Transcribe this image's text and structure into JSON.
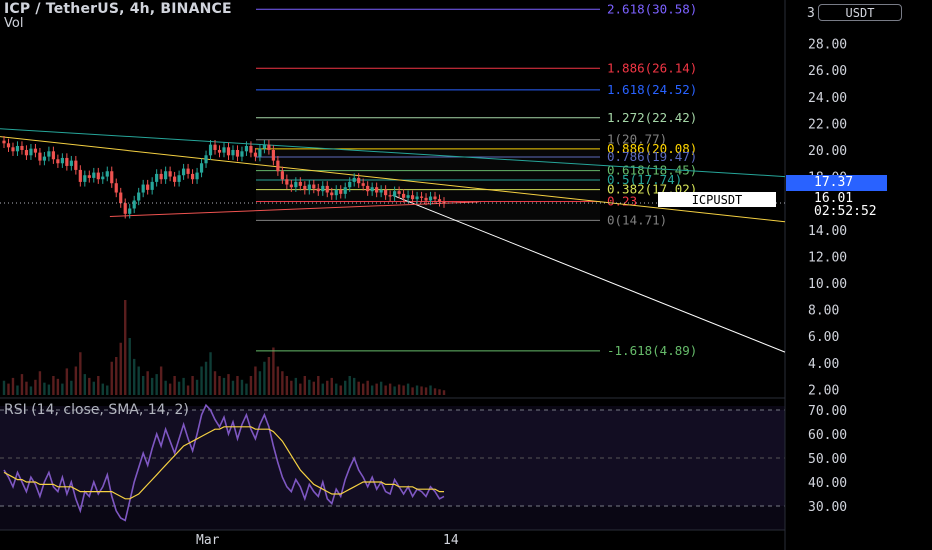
{
  "header": {
    "title": "ICP / TetherUS, 4h, BINANCE",
    "vol_label": "Vol"
  },
  "axis": {
    "unit_button": "USDT",
    "price_ticks": [
      "28.00",
      "26.00",
      "24.00",
      "22.00",
      "20.00",
      "18.00",
      "14.00",
      "12.00",
      "10.00",
      "8.00",
      "6.00",
      "4.00",
      "2.00"
    ],
    "top_tick": "3",
    "rsi_ticks": [
      "70.00",
      "60.00",
      "50.00",
      "40.00",
      "30.00"
    ],
    "time_labels": [
      "Mar",
      "14"
    ]
  },
  "tags": {
    "price_17": "17.37",
    "last_price": "16.01",
    "countdown": "02:52:52",
    "symbol": "ICPUSDT"
  },
  "rsi": {
    "label": "RSI (14, close, SMA, 14, 2)"
  },
  "colors": {
    "up": "#26a69a",
    "down": "#ef5350",
    "rsi_line": "#7e57c2",
    "rsi_sma": "#f5d142",
    "background": "#000000",
    "blue_tag": "#2962ff"
  },
  "chart_data": {
    "type": "candlestick",
    "symbol": "ICPUSDT",
    "interval": "4h",
    "y_range": [
      1.2,
      30.9
    ],
    "last_price": 16.01,
    "fib_levels": [
      {
        "ratio": "2.618",
        "price": 30.58,
        "label": "2.618(30.58)",
        "color": "#7b61ff"
      },
      {
        "ratio": "1.886",
        "price": 26.14,
        "label": "1.886(26.14)",
        "color": "#f23645"
      },
      {
        "ratio": "1.618",
        "price": 24.52,
        "label": "1.618(24.52)",
        "color": "#2962ff"
      },
      {
        "ratio": "1.272",
        "price": 22.42,
        "label": "1.272(22.42)",
        "color": "#a5d6a7"
      },
      {
        "ratio": "1",
        "price": 20.77,
        "label": "1(20.77)",
        "color": "#808080"
      },
      {
        "ratio": "0.886",
        "price": 20.08,
        "label": "0.886(20.08)",
        "color": "#ffd600"
      },
      {
        "ratio": "0.786",
        "price": 19.47,
        "label": "0.786(19.47)",
        "color": "#5c6bc0"
      },
      {
        "ratio": "0.618",
        "price": 18.45,
        "label": "0.618(18.45)",
        "color": "#66bb6a"
      },
      {
        "ratio": "0.5",
        "price": 17.74,
        "label": "0.5(17.74)",
        "color": "#26a69a"
      },
      {
        "ratio": "0.382",
        "price": 17.02,
        "label": "0.382(17.02)",
        "color": "#d4e157"
      },
      {
        "ratio": "0.236",
        "price": 16.13,
        "label": "0.23",
        "color": "#f23645"
      },
      {
        "ratio": "0",
        "price": 14.71,
        "label": "0(14.71)",
        "color": "#808080"
      },
      {
        "ratio": "-1.618",
        "price": 4.89,
        "label": "-1.618(4.89)",
        "color": "#66bb6a"
      }
    ],
    "closes": [
      20.5,
      20.2,
      19.9,
      20.3,
      20.0,
      19.6,
      20.1,
      19.8,
      19.2,
      19.5,
      19.9,
      19.3,
      19.0,
      19.4,
      18.8,
      19.2,
      18.5,
      17.6,
      18.1,
      17.9,
      18.3,
      17.8,
      18.0,
      18.4,
      17.5,
      16.8,
      16.0,
      15.2,
      15.6,
      16.2,
      16.8,
      17.4,
      17.0,
      17.6,
      18.2,
      17.8,
      18.4,
      18.0,
      17.6,
      18.1,
      18.6,
      18.2,
      17.8,
      18.3,
      19.0,
      19.6,
      20.4,
      20.0,
      19.8,
      20.2,
      19.6,
      20.0,
      19.5,
      19.9,
      20.3,
      19.8,
      19.5,
      20.1,
      20.4,
      20.0,
      19.2,
      18.4,
      17.8,
      17.4,
      17.2,
      17.6,
      17.3,
      17.0,
      17.4,
      17.1,
      16.9,
      17.3,
      16.8,
      16.6,
      17.0,
      16.7,
      17.2,
      17.6,
      17.9,
      17.5,
      17.3,
      16.9,
      17.2,
      16.8,
      17.0,
      16.6,
      16.5,
      16.9,
      16.7,
      16.4,
      16.6,
      16.3,
      16.5,
      16.4,
      16.2,
      16.5,
      16.3,
      16.1,
      16.0
    ],
    "volume_relative": [
      0.15,
      0.12,
      0.18,
      0.1,
      0.22,
      0.14,
      0.09,
      0.16,
      0.25,
      0.13,
      0.11,
      0.2,
      0.17,
      0.12,
      0.28,
      0.15,
      0.3,
      0.45,
      0.22,
      0.18,
      0.14,
      0.2,
      0.12,
      0.1,
      0.35,
      0.4,
      0.55,
      1.0,
      0.6,
      0.38,
      0.3,
      0.2,
      0.25,
      0.18,
      0.22,
      0.3,
      0.15,
      0.12,
      0.2,
      0.14,
      0.18,
      0.1,
      0.2,
      0.16,
      0.3,
      0.35,
      0.45,
      0.25,
      0.2,
      0.18,
      0.22,
      0.15,
      0.2,
      0.16,
      0.12,
      0.2,
      0.3,
      0.25,
      0.35,
      0.4,
      0.5,
      0.3,
      0.25,
      0.2,
      0.15,
      0.18,
      0.12,
      0.2,
      0.16,
      0.14,
      0.2,
      0.12,
      0.15,
      0.18,
      0.12,
      0.1,
      0.15,
      0.2,
      0.18,
      0.14,
      0.12,
      0.15,
      0.1,
      0.12,
      0.14,
      0.1,
      0.12,
      0.09,
      0.11,
      0.1,
      0.12,
      0.08,
      0.1,
      0.09,
      0.08,
      0.1,
      0.07,
      0.06,
      0.05
    ],
    "rsi_range": [
      24.5,
      72.8
    ],
    "rsi": [
      45,
      42,
      38,
      44,
      40,
      36,
      42,
      39,
      34,
      40,
      44,
      38,
      36,
      42,
      35,
      40,
      33,
      28,
      36,
      34,
      40,
      35,
      38,
      43,
      34,
      28,
      25,
      24,
      32,
      40,
      46,
      52,
      47,
      54,
      60,
      55,
      62,
      57,
      52,
      58,
      64,
      58,
      53,
      60,
      68,
      72,
      70,
      66,
      63,
      67,
      60,
      65,
      58,
      64,
      68,
      62,
      58,
      64,
      68,
      63,
      55,
      48,
      42,
      38,
      36,
      41,
      38,
      33,
      39,
      36,
      34,
      40,
      33,
      31,
      37,
      34,
      41,
      46,
      50,
      45,
      42,
      38,
      42,
      37,
      40,
      36,
      35,
      41,
      38,
      35,
      38,
      34,
      37,
      36,
      34,
      38,
      36,
      33,
      34
    ],
    "rsi_sma": [
      44,
      43,
      42,
      41,
      41,
      40,
      40,
      40,
      39,
      39,
      39,
      39,
      38,
      38,
      38,
      38,
      37,
      36,
      36,
      36,
      36,
      36,
      36,
      36,
      36,
      35,
      34,
      33,
      33,
      34,
      35,
      37,
      39,
      41,
      43,
      45,
      47,
      49,
      51,
      53,
      55,
      56,
      57,
      58,
      59,
      60,
      61,
      62,
      62,
      63,
      63,
      63,
      63,
      63,
      63,
      63,
      62,
      62,
      62,
      62,
      61,
      59,
      57,
      54,
      51,
      48,
      45,
      43,
      41,
      39,
      38,
      37,
      36,
      35,
      35,
      35,
      36,
      37,
      38,
      39,
      40,
      40,
      40,
      40,
      40,
      39,
      39,
      39,
      38,
      38,
      38,
      38,
      37,
      37,
      37,
      37,
      37,
      36,
      36
    ],
    "trend_lines": [
      {
        "from": [
          0,
          21.6
        ],
        "to": [
          1.0,
          18.0
        ],
        "color": "#26a69a"
      },
      {
        "from": [
          0,
          21.0
        ],
        "to": [
          1.0,
          14.6
        ],
        "color": "#f5d142"
      },
      {
        "from": [
          0.5,
          16.6
        ],
        "to": [
          1.0,
          4.8
        ],
        "color": "#ffffff"
      },
      {
        "from": [
          0.14,
          15.0
        ],
        "to": [
          0.61,
          16.1
        ],
        "color": "#ef5350"
      }
    ]
  }
}
